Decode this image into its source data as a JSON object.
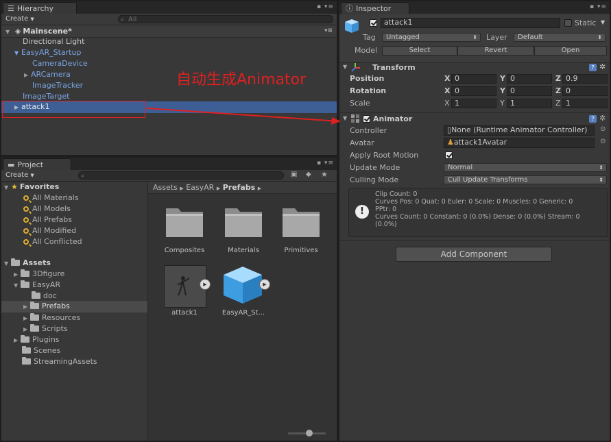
{
  "hierarchy": {
    "tab_label": "Hierarchy",
    "create_label": "Create",
    "search_placeholder": "All",
    "scene_name": "Mainscene*",
    "items": [
      {
        "label": "Directional Light"
      },
      {
        "label": "EasyAR_Startup"
      },
      {
        "label": "CameraDevice"
      },
      {
        "label": "ARCamera"
      },
      {
        "label": "ImageTracker"
      },
      {
        "label": "ImageTarget"
      },
      {
        "label": "attack1"
      }
    ]
  },
  "annotation": {
    "text": "自动生成Animator",
    "color": "#e02020"
  },
  "project": {
    "tab_label": "Project",
    "create_label": "Create",
    "favorites_label": "Favorites",
    "favorites": [
      {
        "label": "All Materials"
      },
      {
        "label": "All Models"
      },
      {
        "label": "All Prefabs"
      },
      {
        "label": "All Modified"
      },
      {
        "label": "All Conflicted"
      }
    ],
    "assets_label": "Assets",
    "tree": [
      {
        "label": "3Dfigure"
      },
      {
        "label": "EasyAR"
      },
      {
        "label": "doc"
      },
      {
        "label": "Prefabs"
      },
      {
        "label": "Resources"
      },
      {
        "label": "Scripts"
      },
      {
        "label": "Plugins"
      },
      {
        "label": "Scenes"
      },
      {
        "label": "StreamingAssets"
      }
    ],
    "breadcrumb": {
      "a": "Assets",
      "b": "EasyAR",
      "c": "Prefabs"
    },
    "grid": [
      {
        "label": "Composites"
      },
      {
        "label": "Materials"
      },
      {
        "label": "Primitives"
      },
      {
        "label": "attack1"
      },
      {
        "label": "EasyAR_St..."
      }
    ]
  },
  "inspector": {
    "tab_label": "Inspector",
    "object_name": "attack1",
    "static_label": "Static",
    "tag_label": "Tag",
    "tag_value": "Untagged",
    "layer_label": "Layer",
    "layer_value": "Default",
    "model_label": "Model",
    "model_buttons": {
      "select": "Select",
      "revert": "Revert",
      "open": "Open"
    },
    "transform": {
      "title": "Transform",
      "rows": [
        {
          "label": "Position",
          "x": "0",
          "y": "0",
          "z": "0.9"
        },
        {
          "label": "Rotation",
          "x": "0",
          "y": "0",
          "z": "0"
        },
        {
          "label": "Scale",
          "x": "1",
          "y": "1",
          "z": "1"
        }
      ],
      "axis": {
        "x": "X",
        "y": "Y",
        "z": "Z"
      }
    },
    "animator": {
      "title": "Animator",
      "controller_label": "Controller",
      "controller_value": "None (Runtime Animator Controller)",
      "avatar_label": "Avatar",
      "avatar_value": "attack1Avatar",
      "apply_root_motion_label": "Apply Root Motion",
      "update_mode_label": "Update Mode",
      "update_mode_value": "Normal",
      "culling_mode_label": "Culling Mode",
      "culling_mode_value": "Cull Update Transforms",
      "info": {
        "line1": "Clip Count: 0",
        "line2": "Curves Pos: 0 Quat: 0 Euler: 0 Scale: 0 Muscles: 0 Generic: 0",
        "line3": "PPtr: 0",
        "line4": "Curves Count: 0 Constant: 0 (0.0%) Dense: 0 (0.0%) Stream: 0",
        "line5": "(0.0%)"
      }
    },
    "add_component_label": "Add Component"
  }
}
